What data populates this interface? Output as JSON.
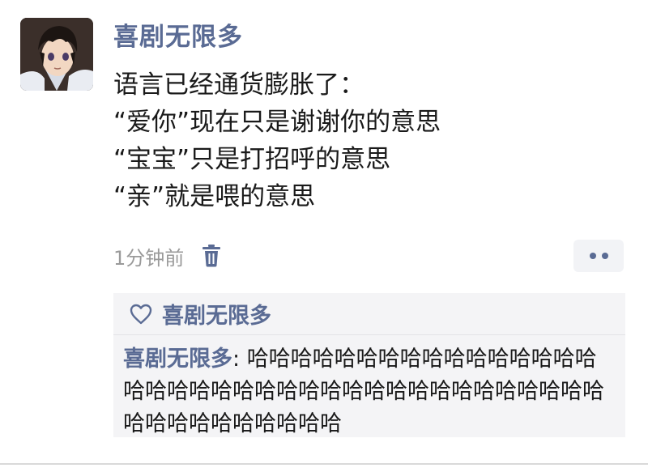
{
  "post": {
    "author": "喜剧无限多",
    "lines": [
      "语言已经通货膨胀了：",
      "“爱你”现在只是谢谢你的意思",
      "“宝宝”只是打招呼的意思",
      "“亲”就是喂的意思"
    ],
    "timestamp": "1分钟前"
  },
  "interactions": {
    "likes": [
      "喜剧无限多"
    ],
    "comments": [
      {
        "author": "喜剧无限多",
        "separator": ": ",
        "text": "哈哈哈哈哈哈哈哈哈哈哈哈哈哈哈哈哈哈哈哈哈哈哈哈哈哈哈哈哈哈哈哈哈哈哈哈哈哈哈哈哈哈哈哈哈哈哈哈"
      }
    ]
  },
  "icons": {
    "delete": "trash-icon",
    "like": "heart-outline-icon",
    "more": "more-dots-icon"
  },
  "colors": {
    "name_link": "#5a6b94",
    "timestamp": "#9a9a9a",
    "interaction_bg": "#f4f4f6"
  }
}
